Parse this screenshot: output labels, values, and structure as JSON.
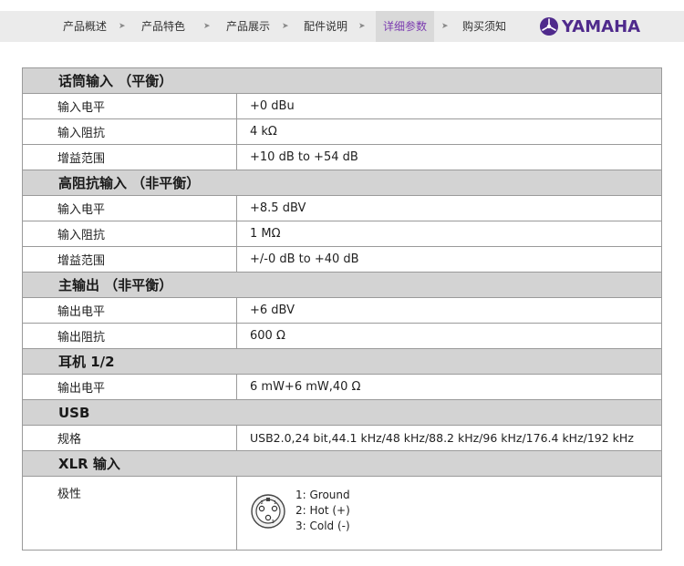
{
  "nav": {
    "items": [
      "产品概述",
      "产品特色",
      "产品展示",
      "配件说明",
      "详细参数",
      "购买须知"
    ],
    "active_index": 4,
    "arrow": "➤",
    "brand": "YAMAHA",
    "brand_icon": "tuning-forks-icon",
    "colors": {
      "bar": "#ebebeb",
      "active_bg": "#d9d9d9",
      "active_text": "#7b3bb0",
      "brand": "#4f2a8c"
    }
  },
  "spec": {
    "sections": [
      {
        "title": "话筒输入 （平衡）",
        "rows": [
          {
            "label": "输入电平",
            "value": "+0 dBu"
          },
          {
            "label": "输入阻抗",
            "value": "4 kΩ"
          },
          {
            "label": "增益范围",
            "value": "+10 dB to +54 dB"
          }
        ]
      },
      {
        "title": "高阻抗输入 （非平衡）",
        "rows": [
          {
            "label": "输入电平",
            "value": "+8.5 dBV"
          },
          {
            "label": "输入阻抗",
            "value": "1 MΩ"
          },
          {
            "label": "增益范围",
            "value": "+/-0 dB to +40 dB"
          }
        ]
      },
      {
        "title": "主输出 （非平衡）",
        "rows": [
          {
            "label": "输出电平",
            "value": "+6 dBV"
          },
          {
            "label": "输出阻抗",
            "value": "600 Ω"
          }
        ]
      },
      {
        "title": "耳机 1/2",
        "rows": [
          {
            "label": "输出电平",
            "value": "6 mW+6 mW,40 Ω"
          }
        ]
      },
      {
        "title": "USB",
        "rows": [
          {
            "label": "规格",
            "value": "USB2.0,24 bit,44.1 kHz/48 kHz/88.2 kHz/96 kHz/176.4 kHz/192 kHz"
          }
        ]
      },
      {
        "title": "XLR 输入",
        "rows": [
          {
            "label": "极性",
            "polarity": [
              "1: Ground",
              "2: Hot (+)",
              "3: Cold (-)"
            ],
            "icon": "xlr-connector-icon"
          }
        ]
      }
    ]
  }
}
